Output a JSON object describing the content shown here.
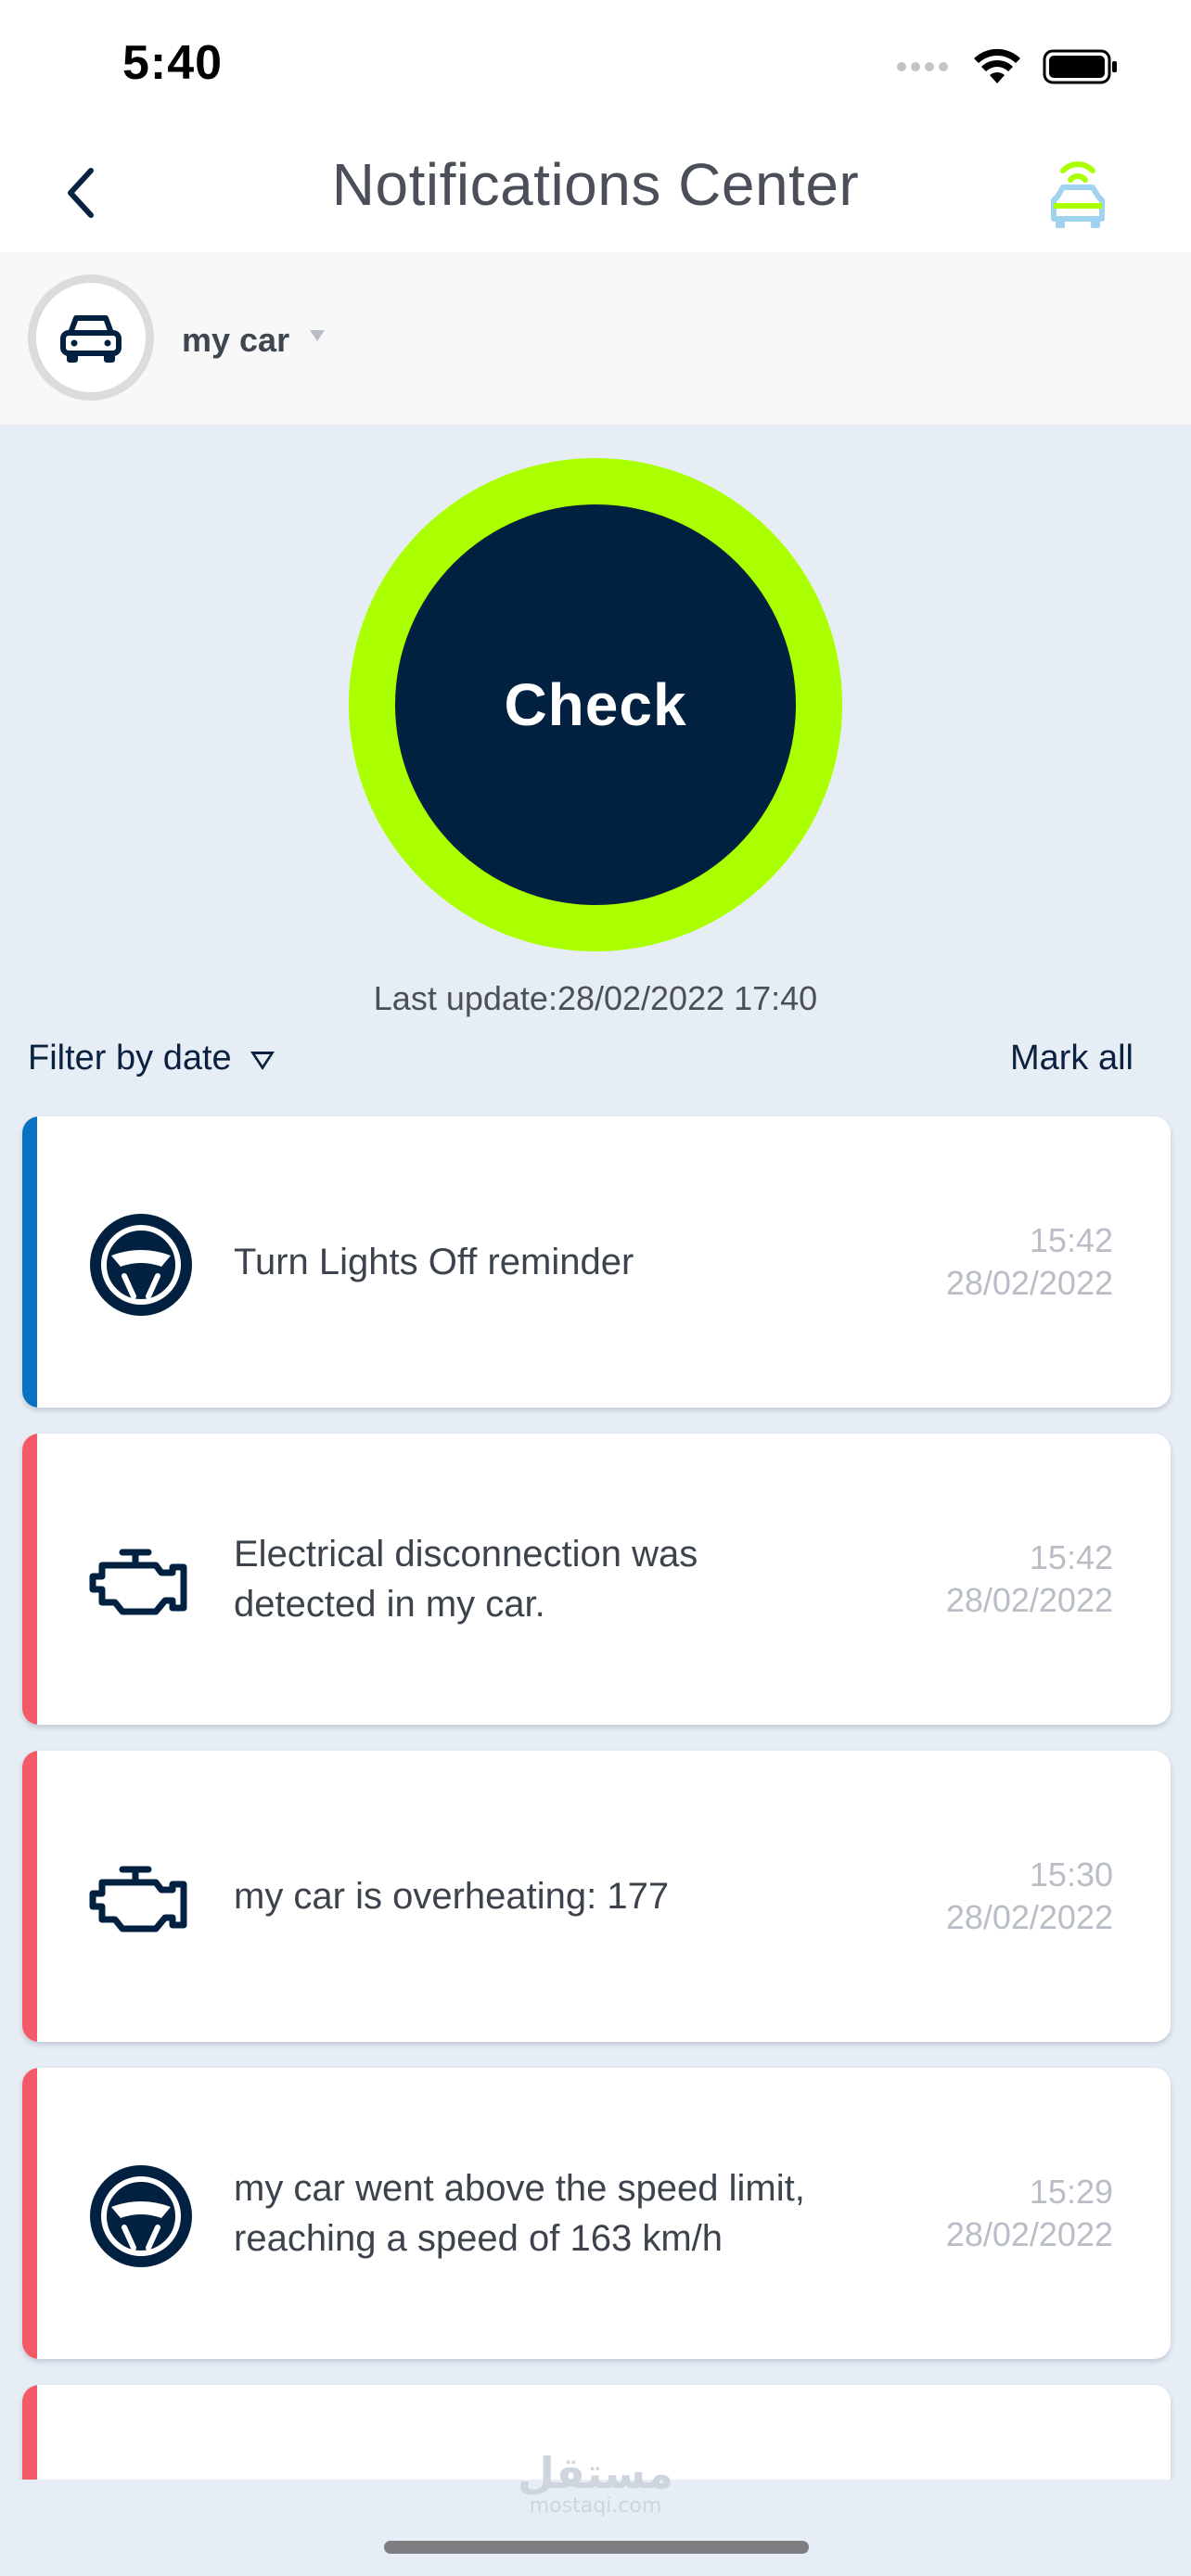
{
  "status_bar": {
    "time": "5:40"
  },
  "header": {
    "title": "Notifications Center"
  },
  "vehicle": {
    "name": "my car"
  },
  "check": {
    "label": "Check",
    "last_update": "Last update:28/02/2022 17:40"
  },
  "filters": {
    "filter_label": "Filter by date",
    "mark_all_label": "Mark all"
  },
  "notifications": [
    {
      "text": "Turn Lights Off reminder",
      "time": "15:42",
      "date": "28/02/2022",
      "icon": "steering-wheel-icon",
      "accent": "#0a72c2"
    },
    {
      "text": "Electrical disconnection was detected in my car.",
      "time": "15:42",
      "date": "28/02/2022",
      "icon": "engine-icon",
      "accent": "#f35a68"
    },
    {
      "text": "my car is overheating: 177",
      "time": "15:30",
      "date": "28/02/2022",
      "icon": "engine-icon",
      "accent": "#f35a68"
    },
    {
      "text": "my car went above the speed limit, reaching a speed of 163 km/h",
      "time": "15:29",
      "date": "28/02/2022",
      "icon": "steering-wheel-icon",
      "accent": "#f35a68"
    }
  ],
  "watermark": {
    "logo": "مستقل",
    "site": "mostaqi.com"
  },
  "colors": {
    "ring": "#aaff00",
    "button": "#022140",
    "background": "#e7edf5"
  }
}
